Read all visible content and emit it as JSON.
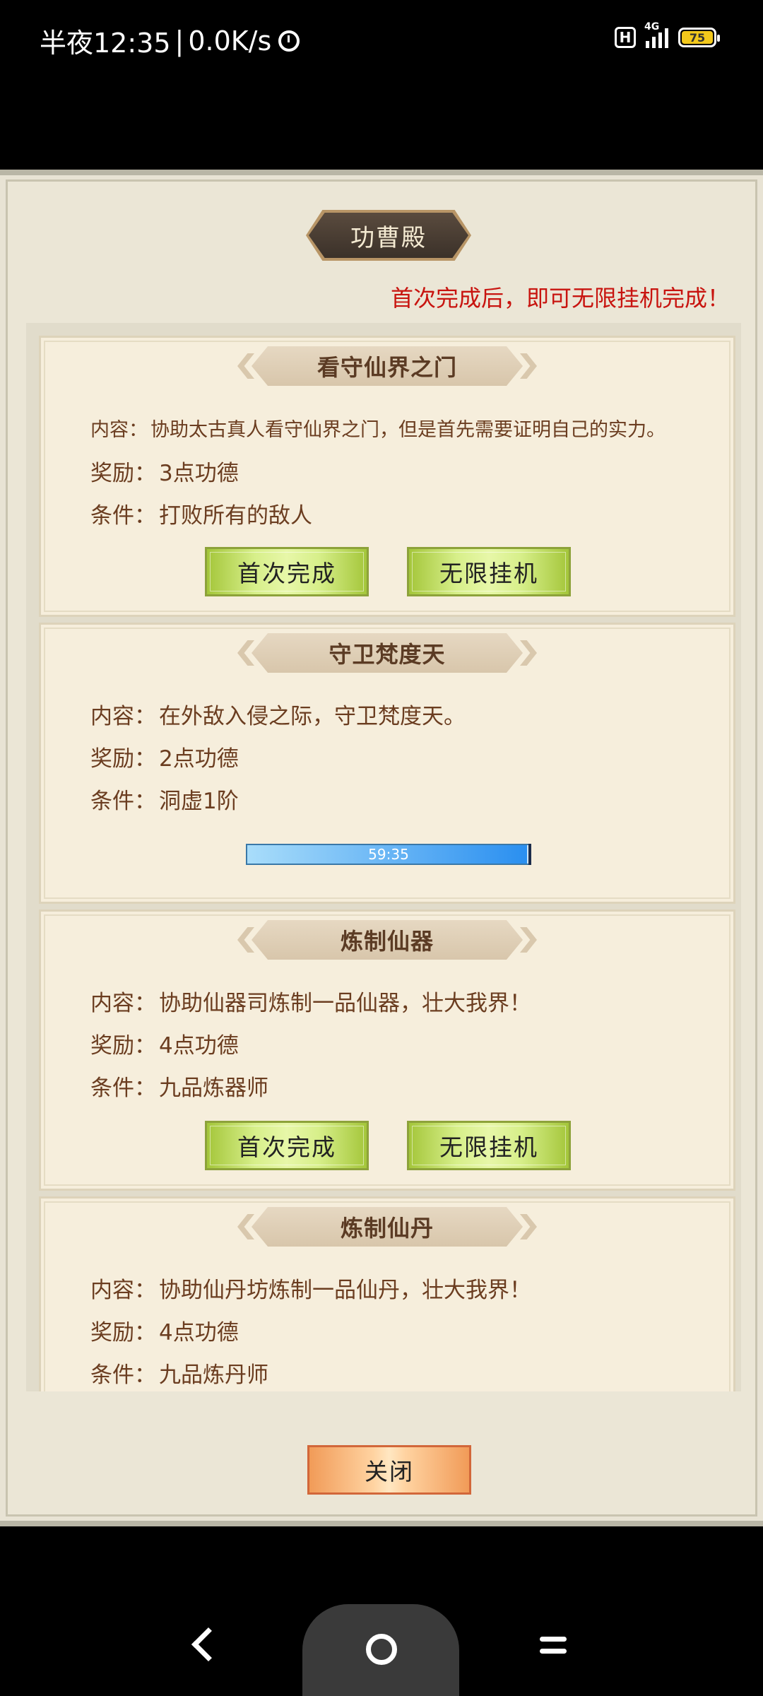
{
  "status_bar": {
    "time": "半夜12:35",
    "separator": "|",
    "network_speed": "0.0K/s",
    "network_type": "4G",
    "battery_level": "75",
    "hd_badge": "H",
    "icons": [
      "alarm-icon",
      "hd-icon",
      "signal-icon",
      "battery-icon"
    ]
  },
  "dialog": {
    "title": "功曹殿",
    "notice": "首次完成后，即可无限挂机完成！",
    "close_label": "关闭"
  },
  "tasks": [
    {
      "name": "看守仙界之门",
      "content_label": "内容：",
      "content": "协助太古真人看守仙界之门，但是首先需要证明自己的实力。",
      "reward_label": "奖励：",
      "reward": "3点功德",
      "condition_label": "条件：",
      "condition": "打败所有的敌人",
      "first_complete_label": "首次完成",
      "idle_label": "无限挂机"
    },
    {
      "name": "守卫梵度天",
      "content_label": "内容：",
      "content": "在外敌入侵之际，守卫梵度天。",
      "reward_label": "奖励：",
      "reward": "2点功德",
      "condition_label": "条件：",
      "condition": "洞虚1阶",
      "timer": "59:35",
      "timer_progress": 0.99
    },
    {
      "name": "炼制仙器",
      "content_label": "内容：",
      "content": "协助仙器司炼制一品仙器，壮大我界！",
      "reward_label": "奖励：",
      "reward": "4点功德",
      "condition_label": "条件：",
      "condition": "九品炼器师",
      "first_complete_label": "首次完成",
      "idle_label": "无限挂机"
    },
    {
      "name": "炼制仙丹",
      "content_label": "内容：",
      "content": "协助仙丹坊炼制一品仙丹，壮大我界！",
      "reward_label": "奖励：",
      "reward": "4点功德",
      "condition_label": "条件：",
      "condition": "九品炼丹师"
    }
  ],
  "nav_bar": {
    "icons": [
      "back-icon",
      "home-icon",
      "menu-icon"
    ]
  },
  "colors": {
    "notice": "#c8140f",
    "card_text": "#6b3d20",
    "button_green": "#a4c63a",
    "button_orange": "#f19b58",
    "progress_blue": "#2a8ff0"
  }
}
